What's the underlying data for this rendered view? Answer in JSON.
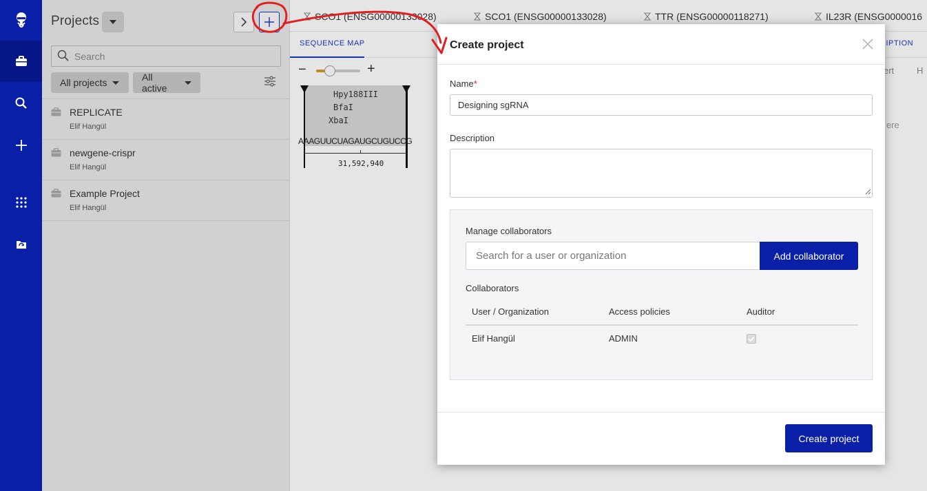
{
  "rail": {
    "items": [
      "logo-icon",
      "briefcase-icon",
      "search-icon",
      "plus-icon",
      "apps-grid-icon",
      "folder-sync-icon"
    ]
  },
  "projects_panel": {
    "title": "Projects",
    "search_placeholder": "Search",
    "filter_all": "All projects",
    "filter_active": "All active",
    "items": [
      {
        "name": "REPLICATE",
        "owner": "Elif Hangül"
      },
      {
        "name": "newgene-crispr",
        "owner": "Elif Hangül"
      },
      {
        "name": "Example Project",
        "owner": "Elif Hangül"
      }
    ]
  },
  "doc_tabs": [
    "SCO1 (ENSG00000133028)",
    "SCO1 (ENSG00000133028)",
    "TTR (ENSG00000118271)",
    "IL23R (ENSG0000016"
  ],
  "sequence_view": {
    "tab": "SEQUENCE MAP",
    "right_tab": "RIPTION",
    "enzymes": [
      "Hpy188III",
      "BfaI",
      "XbaI"
    ],
    "sequence": "AAAGUUCUAGAUGCUGUCCG",
    "position": "31,592,940",
    "right_partial_1": "ert",
    "right_partial_2": "H",
    "right_partial_3": "ere"
  },
  "modal": {
    "title": "Create project",
    "name_label": "Name",
    "name_required_mark": "*",
    "name_value": "Designing sgRNA",
    "description_label": "Description",
    "description_value": "",
    "manage_label": "Manage collaborators",
    "collab_search_placeholder": "Search for a user or organization",
    "add_collaborator": "Add collaborator",
    "collaborators_label": "Collaborators",
    "table_headers": [
      "User / Organization",
      "Access policies",
      "Auditor"
    ],
    "rows": [
      {
        "user": "Elif Hangül",
        "access": "ADMIN",
        "auditor": true
      }
    ],
    "create_button": "Create project"
  },
  "colors": {
    "brand": "#0a1fa8",
    "annotation": "#e02020",
    "link": "#1a3ac9"
  }
}
